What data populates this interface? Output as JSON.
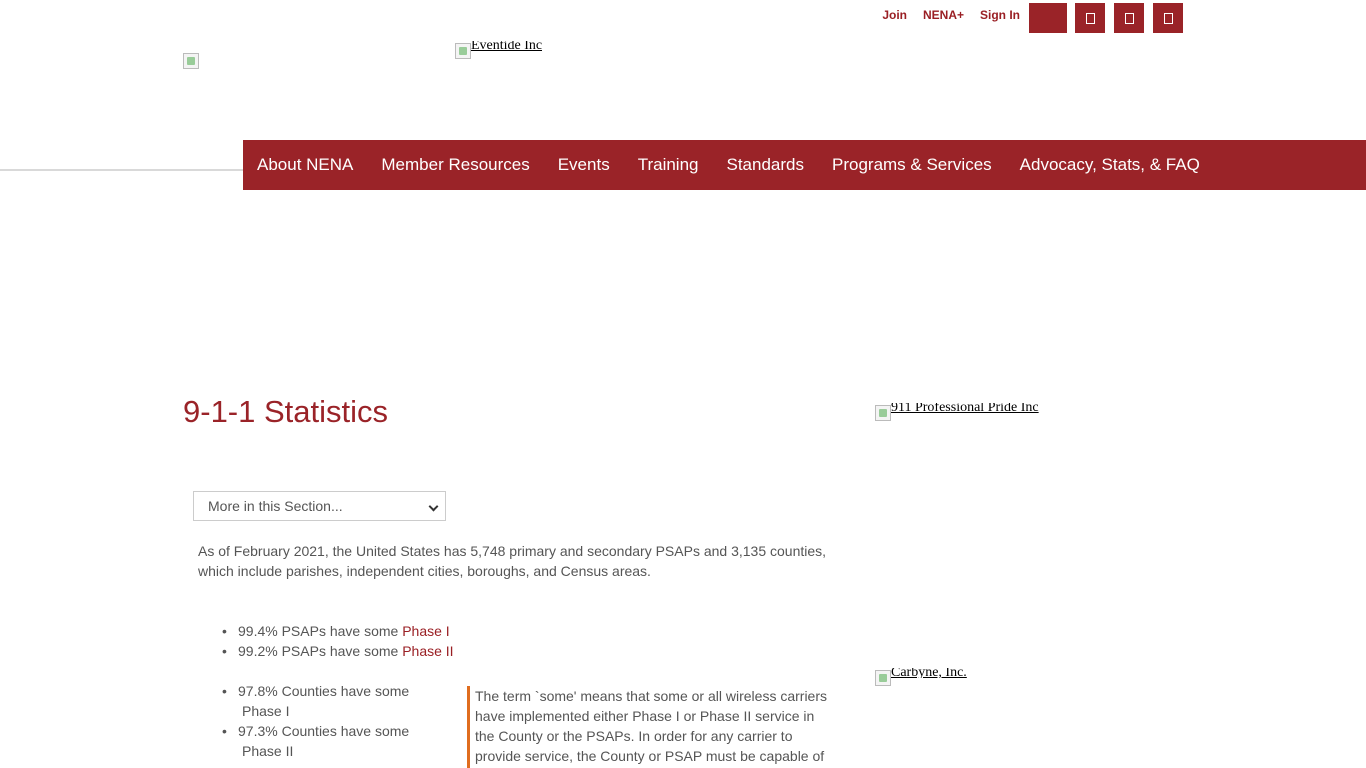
{
  "topbar": {
    "links": {
      "join": "Join",
      "nena_plus": "NENA+",
      "sign_in": "Sign In"
    },
    "icons": [
      "cart-icon",
      "facebook-icon",
      "twitter-icon",
      "linkedin-icon"
    ]
  },
  "logos": {
    "ad_top_alt": "Eventide Inc",
    "ad_right1_alt": "911 Professional Pride Inc",
    "ad_right2_alt": "Carbyne, Inc."
  },
  "nav": {
    "items": [
      "About NENA",
      "Member Resources",
      "Events",
      "Training",
      "Standards",
      "Programs & Services",
      "Advocacy, Stats, & FAQ"
    ]
  },
  "main": {
    "title": "9-1-1 Statistics",
    "section_select": "More in this Section...",
    "intro": "As of February 2021, the United States has 5,748 primary and secondary PSAPs and 3,135 counties, which include parishes, independent cities, boroughs, and Census areas.",
    "stats": [
      {
        "text": "99.4% PSAPs have some ",
        "link": "Phase I"
      },
      {
        "text": "99.2% PSAPs have some ",
        "link": "Phase II"
      },
      {
        "text": "97.8% Counties have some",
        "suffix": "Phase I"
      },
      {
        "text": "97.3% Counties have some",
        "suffix": "Phase II"
      }
    ],
    "callout": "The term `some' means that some or all wireless carriers have implemented either Phase I or Phase II service in the County or the PSAPs. In order for any carrier to provide service, the County or PSAP must be capable of"
  },
  "colors": {
    "brand": "#9a2328",
    "accent_border": "#e06d1f",
    "text": "#555555"
  }
}
